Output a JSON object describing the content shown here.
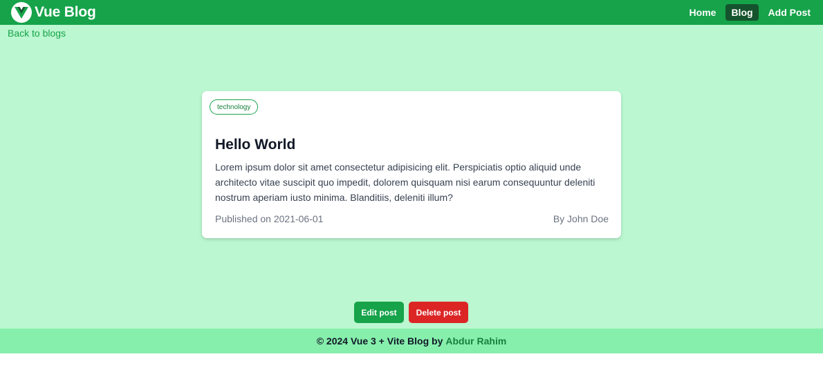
{
  "header": {
    "brand_text": "Vue Blog",
    "logo_icon": "vue-logo-icon",
    "nav": [
      {
        "label": "Home",
        "active": false
      },
      {
        "label": "Blog",
        "active": true
      },
      {
        "label": "Add Post",
        "active": false
      }
    ]
  },
  "main": {
    "back_link": "Back to blogs"
  },
  "post": {
    "tag": "technology",
    "title": "Hello World",
    "body": "Lorem ipsum dolor sit amet consectetur adipisicing elit. Perspiciatis optio aliquid unde architecto vitae suscipit quo impedit, dolorem quisquam nisi earum consequuntur deleniti nostrum aperiam iusto minima. Blanditiis, deleniti illum?",
    "published": "Published on 2021-06-01",
    "author": "By John Doe"
  },
  "actions": {
    "edit_label": "Edit post",
    "delete_label": "Delete post"
  },
  "footer": {
    "text": "© 2024 Vue 3 + Vite Blog by",
    "author_link": "Abdur Rahim"
  },
  "colors": {
    "navbar": "#16a34a",
    "page_bg": "#bbf7d0",
    "footer_bg": "#86efac",
    "active_nav": "#14532d",
    "delete": "#dc2626"
  }
}
